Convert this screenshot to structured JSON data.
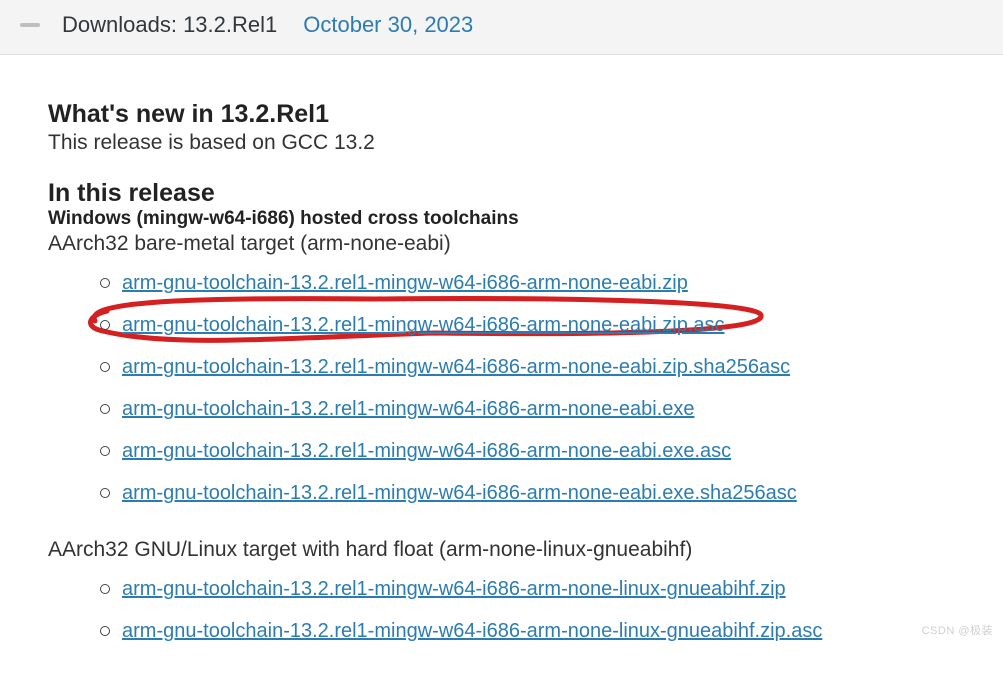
{
  "header": {
    "title": "Downloads: 13.2.Rel1",
    "date": "October 30, 2023"
  },
  "whatsnew": {
    "heading": "What's new in 13.2.Rel1",
    "description": "This release is based on GCC 13.2"
  },
  "release": {
    "heading": "In this release",
    "section1": {
      "host": "Windows (mingw-w64-i686) hosted cross toolchains",
      "target": "AArch32 bare-metal target (arm-none-eabi)",
      "links": [
        "arm-gnu-toolchain-13.2.rel1-mingw-w64-i686-arm-none-eabi.zip",
        "arm-gnu-toolchain-13.2.rel1-mingw-w64-i686-arm-none-eabi.zip.asc",
        "arm-gnu-toolchain-13.2.rel1-mingw-w64-i686-arm-none-eabi.zip.sha256asc",
        "arm-gnu-toolchain-13.2.rel1-mingw-w64-i686-arm-none-eabi.exe",
        "arm-gnu-toolchain-13.2.rel1-mingw-w64-i686-arm-none-eabi.exe.asc",
        "arm-gnu-toolchain-13.2.rel1-mingw-w64-i686-arm-none-eabi.exe.sha256asc"
      ]
    },
    "section2": {
      "target": "AArch32 GNU/Linux target with hard float (arm-none-linux-gnueabihf)",
      "links": [
        "arm-gnu-toolchain-13.2.rel1-mingw-w64-i686-arm-none-linux-gnueabihf.zip",
        "arm-gnu-toolchain-13.2.rel1-mingw-w64-i686-arm-none-linux-gnueabihf.zip.asc"
      ]
    }
  },
  "watermark": "CSDN @极装"
}
